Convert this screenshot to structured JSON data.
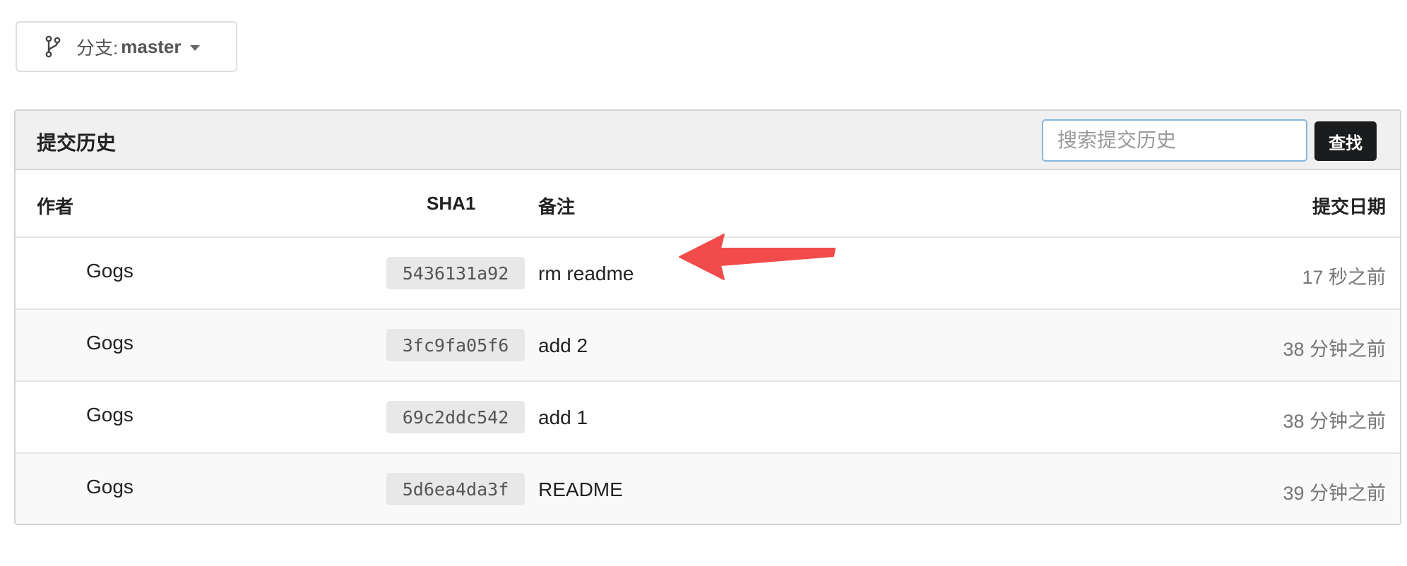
{
  "branch": {
    "prefix": "分支:",
    "name": "master"
  },
  "commits_panel": {
    "title": "提交历史",
    "search": {
      "placeholder": "搜索提交历史",
      "button_label": "查找"
    },
    "columns": {
      "author": "作者",
      "sha": "SHA1",
      "message": "备注",
      "date": "提交日期"
    },
    "rows": [
      {
        "author": "Gogs",
        "sha": "5436131a92",
        "message": "rm readme",
        "date": "17 秒之前"
      },
      {
        "author": "Gogs",
        "sha": "3fc9fa05f6",
        "message": "add 2",
        "date": "38 分钟之前"
      },
      {
        "author": "Gogs",
        "sha": "69c2ddc542",
        "message": "add 1",
        "date": "38 分钟之前"
      },
      {
        "author": "Gogs",
        "sha": "5d6ea4da3f",
        "message": "README",
        "date": "39 分钟之前"
      }
    ]
  },
  "icons": {
    "branch": "git-branch-icon",
    "caret": "caret-down-icon",
    "arrow": "red-annotation-arrow"
  },
  "colors": {
    "button_bg": "#1b1c1d",
    "input_focus_border": "#85b7d9",
    "arrow": "#f24b4b",
    "header_bg": "#f0f0f0"
  }
}
